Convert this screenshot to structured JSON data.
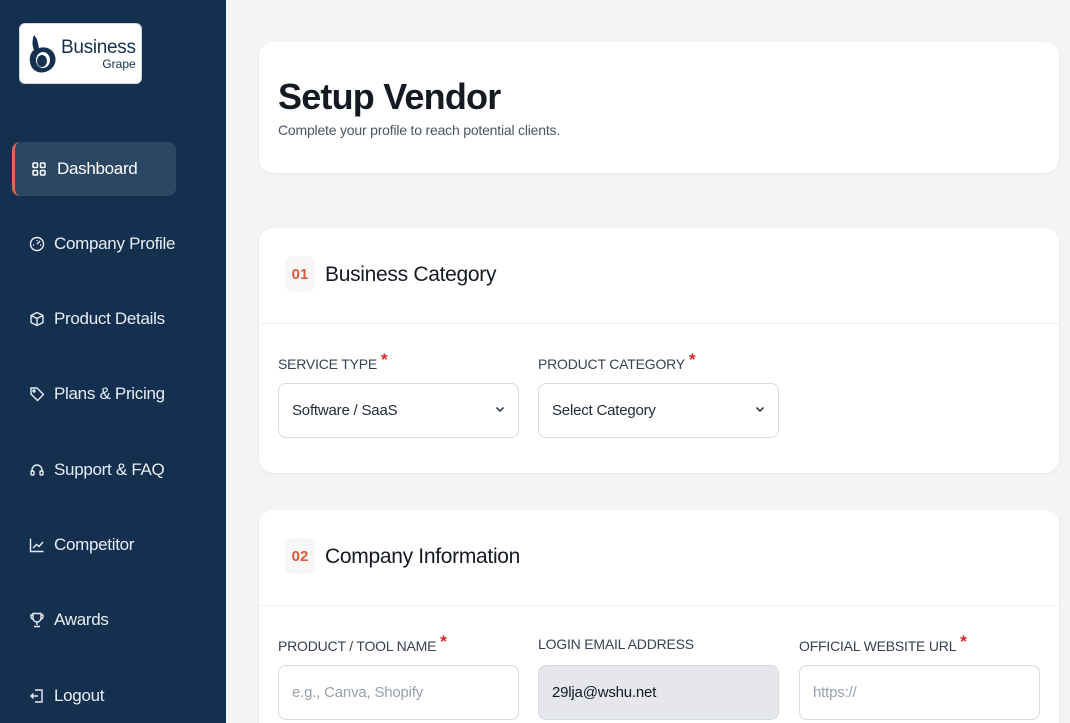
{
  "brand": {
    "name": "Business",
    "sub": "Grape",
    "color": "#14304e"
  },
  "sidebar": {
    "items": [
      {
        "label": "Dashboard",
        "icon": "grid-icon",
        "active": true
      },
      {
        "label": "Company Profile",
        "icon": "gauge-icon"
      },
      {
        "label": "Product Details",
        "icon": "box-icon"
      },
      {
        "label": "Plans & Pricing",
        "icon": "tag-icon"
      },
      {
        "label": "Support & FAQ",
        "icon": "headset-icon"
      },
      {
        "label": "Competitor",
        "icon": "trend-chart-icon"
      },
      {
        "label": "Awards",
        "icon": "trophy-icon"
      },
      {
        "label": "Logout",
        "icon": "logout-icon"
      }
    ]
  },
  "header": {
    "title": "Setup Vendor",
    "subtitle": "Complete your profile to reach potential clients."
  },
  "sections": [
    {
      "number": "01",
      "title": "Business Category",
      "fields": [
        {
          "label": "SERVICE TYPE",
          "required": true,
          "value": "Software / SaaS"
        },
        {
          "label": "PRODUCT CATEGORY",
          "required": true,
          "value": "Select Category"
        }
      ]
    },
    {
      "number": "02",
      "title": "Company Information",
      "fields": [
        {
          "label": "PRODUCT / TOOL NAME",
          "required": true,
          "placeholder": "e.g., Canva, Shopify"
        },
        {
          "label": "LOGIN EMAIL ADDRESS",
          "required": false,
          "value": "29lja@wshu.net"
        },
        {
          "label": "OFFICIAL WEBSITE URL",
          "required": true,
          "placeholder": "https://"
        }
      ]
    }
  ],
  "colors": {
    "sidebar": "#14304e",
    "active_item": "#2b4764",
    "accent": "#e0684b",
    "required": "#dc2626"
  }
}
